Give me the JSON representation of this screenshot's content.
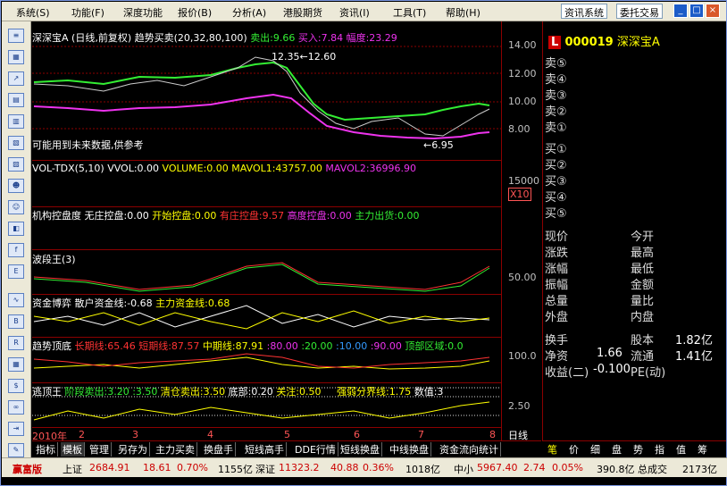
{
  "menu": {
    "items": [
      "系统(S)",
      "功能(F)",
      "深度功能",
      "报价(B)",
      "分析(A)",
      "港股期货",
      "资讯(I)",
      "工具(T)",
      "帮助(H)"
    ],
    "btn1": "资讯系统",
    "btn2": "委托交易"
  },
  "window_controls": {
    "min": "_",
    "max": "□",
    "close": "×"
  },
  "main": {
    "stock_label": "深深宝A",
    "period": "(日线,前复权)",
    "indicator": "趋势买卖(20,32,80,100)",
    "sell": "卖出:9.66",
    "buy": "买入:7.84",
    "range": "幅度:23.29",
    "high_marker": "12.35←12.60",
    "low_marker": "←6.95",
    "note": "可能用到未来数据,供参考",
    "y_ticks": [
      "14.00",
      "12.00",
      "10.00",
      "8.00"
    ]
  },
  "volume": {
    "title": "VOL-TDX(5,10)",
    "vvol": "VVOL:0.00",
    "volume": "VOLUME:0.00",
    "mavol1": "MAVOL1:43757.00",
    "mavol2": "MAVOL2:36996.90",
    "y_tick": "15000",
    "unit": "X10"
  },
  "control": {
    "title": "机构控盘度",
    "items": [
      "无庄控盘:0.00",
      "开始控盘:0.00",
      "有庄控盘:9.57",
      "高度控盘:0.00",
      "主力出货:0.00"
    ]
  },
  "wave": {
    "title": "波段王(3)",
    "y_tick": "50.00"
  },
  "capital": {
    "title": "资金博弈",
    "retail": "散户资金线:-0.68",
    "main": "主力资金线:0.68"
  },
  "trend": {
    "title": "趋势顶底",
    "long": "长期线:65.46",
    "short": "短期线:87.57",
    "mid": "中期线:87.91",
    "v1": ":80.00",
    "v2": ":20.00",
    "v3": ":10.00",
    "v4": ":90.00",
    "top": "顶部区域:0.0",
    "y_tick": "100.0"
  },
  "escape": {
    "title": "逃顶王",
    "stage": "阶段卖出:3.20",
    "v": ":3.50",
    "clear": "清仓卖出:3.50",
    "bottom": "底部:0.20",
    "focus": "关注:0.50",
    "strength": "强弱分界线:1.75",
    "value": "数值:3",
    "y_tick": "2.50"
  },
  "xaxis": {
    "year": "2010年",
    "months": [
      "2",
      "3",
      "4",
      "5",
      "6",
      "7",
      "8"
    ],
    "period_label": "日线"
  },
  "quote": {
    "code": "000019",
    "name": "深深宝A",
    "sell": [
      "卖⑤",
      "卖④",
      "卖③",
      "卖②",
      "卖①"
    ],
    "buy": [
      "买①",
      "买②",
      "买③",
      "买④",
      "买⑤"
    ],
    "fields": [
      [
        "现价",
        "今开"
      ],
      [
        "涨跌",
        "最高"
      ],
      [
        "涨幅",
        "最低"
      ],
      [
        "振幅",
        "金额"
      ],
      [
        "总量",
        "量比"
      ],
      [
        "外盘",
        "内盘"
      ]
    ],
    "turnover": "换手",
    "equity": "股本",
    "equity_val": "1.82亿",
    "nav": "净资",
    "nav_val": "1.66",
    "float": "流通",
    "float_val": "1.41亿",
    "eps": "收益(二)",
    "eps_val": "-0.100",
    "pe": "PE(动)"
  },
  "tabs": [
    "指标",
    "模板",
    "管理",
    "另存为",
    "主力买卖",
    "换盘手",
    "短线高手",
    "DDE行情",
    "短线换盘",
    "中线换盘",
    "资金流向统计"
  ],
  "right_tabs": [
    "笔",
    "价",
    "细",
    "盘",
    "势",
    "指",
    "值",
    "筹"
  ],
  "status": {
    "brand": "赢富版",
    "sh": "上证",
    "sh_val": "2684.91",
    "sh_chg": "18.61",
    "sh_pct": "0.70%",
    "sh_amt": "1155亿",
    "sz": "深证",
    "sz_val": "11323.2",
    "sz_chg": "40.88",
    "sz_pct": "0.36%",
    "sz_amt": "1018亿",
    "zx": "中小",
    "zx_val": "5967.40",
    "zx_chg": "2.74",
    "zx_pct": "0.05%",
    "zx_amt": "390.8亿",
    "total": "总成交",
    "total_amt": "2173亿"
  }
}
